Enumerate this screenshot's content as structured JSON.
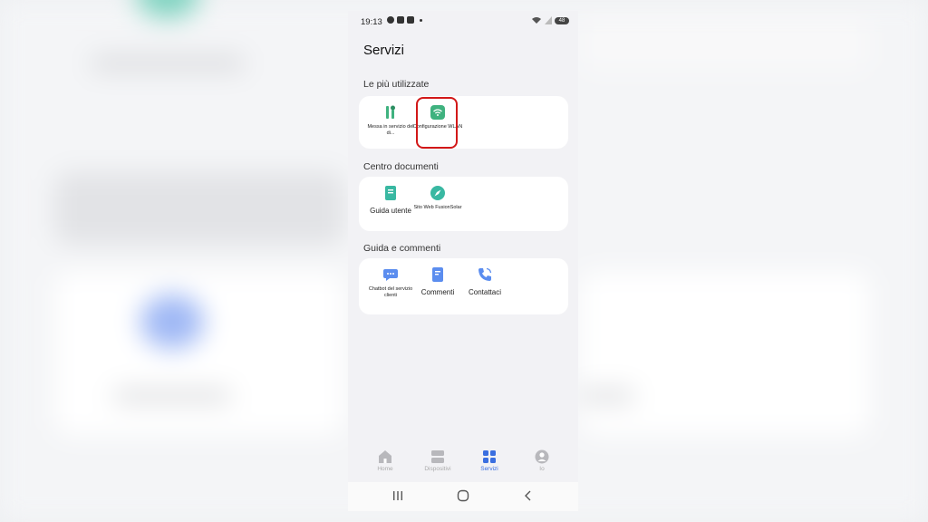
{
  "status": {
    "time": "19:13",
    "battery": "48"
  },
  "title": "Servizi",
  "sections": [
    {
      "label": "Le più utilizzate",
      "items": [
        {
          "label": "Messa in servizio del di...",
          "icon": "tools-icon"
        },
        {
          "label": "Configurazione WLAN",
          "icon": "wifi-icon"
        }
      ]
    },
    {
      "label": "Centro documenti",
      "items": [
        {
          "label": "Guida utente",
          "icon": "book-icon"
        },
        {
          "label": "Sito Web FusionSolar",
          "icon": "compass-icon"
        }
      ]
    },
    {
      "label": "Guida e commenti",
      "items": [
        {
          "label": "Chatbot del servizio clienti",
          "icon": "chat-icon"
        },
        {
          "label": "Commenti",
          "icon": "feedback-icon"
        },
        {
          "label": "Contattaci",
          "icon": "phone-icon"
        }
      ]
    }
  ],
  "nav": [
    {
      "label": "Home",
      "icon": "home-icon",
      "active": false
    },
    {
      "label": "Dispositivi",
      "icon": "devices-icon",
      "active": false
    },
    {
      "label": "Servizi",
      "icon": "grid-icon",
      "active": true
    },
    {
      "label": "Io",
      "icon": "user-icon",
      "active": false
    }
  ],
  "colors": {
    "accent": "#3b6fe0",
    "green": "#3fb27f",
    "teal": "#39b8a2",
    "blue": "#5b8def",
    "highlight": "#d21818"
  }
}
